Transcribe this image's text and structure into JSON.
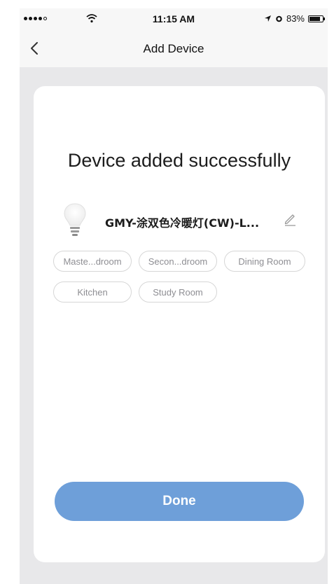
{
  "status_bar": {
    "time": "11:15 AM",
    "battery": "83%",
    "battery_level": 0.83,
    "icons": [
      "signal-icon",
      "wifi-icon",
      "location-arrow-icon",
      "alarm-icon",
      "battery-icon"
    ]
  },
  "nav": {
    "title": "Add Device",
    "back_icon": "chevron-left-icon"
  },
  "main": {
    "headline": "Device added successfully",
    "device": {
      "name": "GMY-涂双色冷暖灯(CW)-L...",
      "icon": "light-bulb-icon",
      "edit_icon": "pencil-icon"
    },
    "rooms": [
      "Maste...droom",
      "Secon...droom",
      "Dining Room",
      "Kitchen",
      "Study Room"
    ],
    "done_label": "Done"
  },
  "colors": {
    "accent": "#6e9fd9",
    "background": "#e8e8ea",
    "card": "#ffffff",
    "chip_border": "#d6d6d6",
    "chip_text": "#8e8e93"
  }
}
